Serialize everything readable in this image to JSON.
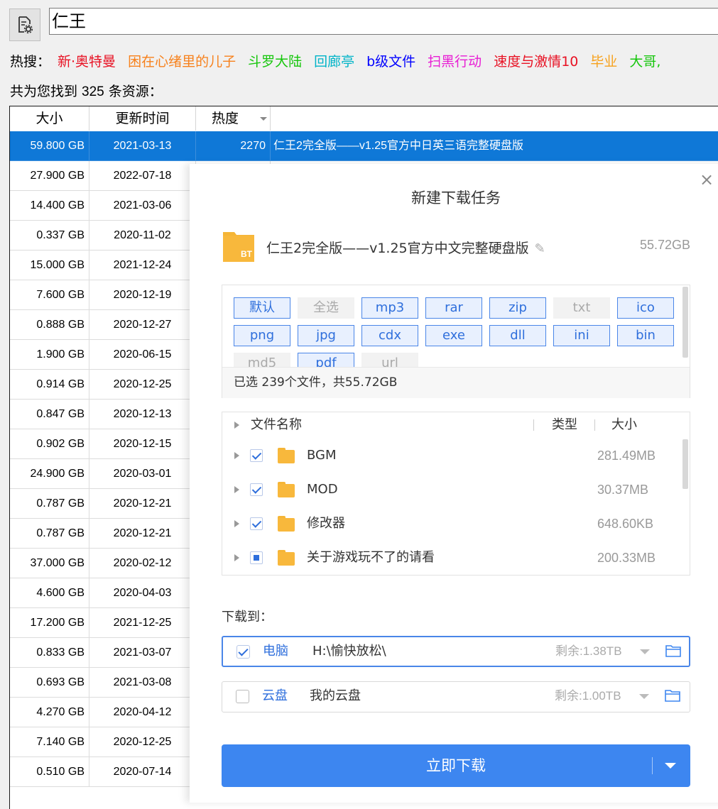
{
  "search": {
    "value": "仁王"
  },
  "hot": {
    "label": "热搜：",
    "keywords": [
      {
        "text": "新·奥特曼",
        "color": "#e81123"
      },
      {
        "text": "困在心绪里的儿子",
        "color": "#f7811c"
      },
      {
        "text": "斗罗大陆",
        "color": "#16c60c"
      },
      {
        "text": "回廊亭",
        "color": "#00b4c8"
      },
      {
        "text": "b级文件",
        "color": "#0000ff"
      },
      {
        "text": "扫黑行动",
        "color": "#e81cd4"
      },
      {
        "text": "速度与激情10",
        "color": "#e81123"
      },
      {
        "text": "毕业",
        "color": "#f7a11c"
      },
      {
        "text": "大哥,",
        "color": "#16c60c"
      }
    ]
  },
  "found": {
    "prefix": "共为您找到 ",
    "count": "325",
    "suffix": " 条资源："
  },
  "table": {
    "headers": [
      "大小",
      "更新时间",
      "热度"
    ],
    "rows": [
      {
        "size": "59.800 GB",
        "date": "2021-03-13",
        "heat": "2270",
        "name": "仁王2完全版——v1.25官方中日英三语完整硬盘版",
        "selected": true
      },
      {
        "size": "27.900 GB",
        "date": "2022-07-18"
      },
      {
        "size": "14.400 GB",
        "date": "2021-03-06"
      },
      {
        "size": "0.337 GB",
        "date": "2020-11-02"
      },
      {
        "size": "15.000 GB",
        "date": "2021-12-24"
      },
      {
        "size": "7.600 GB",
        "date": "2020-12-19"
      },
      {
        "size": "0.888 GB",
        "date": "2020-12-27"
      },
      {
        "size": "1.900 GB",
        "date": "2020-06-15"
      },
      {
        "size": "0.914 GB",
        "date": "2020-12-25"
      },
      {
        "size": "0.847 GB",
        "date": "2020-12-13"
      },
      {
        "size": "0.902 GB",
        "date": "2020-12-15"
      },
      {
        "size": "24.900 GB",
        "date": "2020-03-01"
      },
      {
        "size": "0.787 GB",
        "date": "2020-12-21"
      },
      {
        "size": "0.787 GB",
        "date": "2020-12-21"
      },
      {
        "size": "37.000 GB",
        "date": "2020-02-12"
      },
      {
        "size": "4.600 GB",
        "date": "2020-04-03"
      },
      {
        "size": "17.200 GB",
        "date": "2021-12-25"
      },
      {
        "size": "0.833 GB",
        "date": "2021-03-07"
      },
      {
        "size": "0.693 GB",
        "date": "2021-03-08"
      },
      {
        "size": "4.270 GB",
        "date": "2020-04-12"
      },
      {
        "size": "7.140 GB",
        "date": "2020-12-25"
      },
      {
        "size": "0.510 GB",
        "date": "2020-07-14"
      }
    ]
  },
  "dialog": {
    "close": "×",
    "title": "新建下载任务",
    "file_badge": "BT",
    "file_name": "仁王2完全版——v1.25官方中文完整硬盘版",
    "file_size": "55.72GB",
    "types": [
      {
        "label": "默认",
        "on": true
      },
      {
        "label": "全选",
        "on": false
      },
      {
        "label": "mp3",
        "on": true
      },
      {
        "label": "rar",
        "on": true
      },
      {
        "label": "zip",
        "on": true
      },
      {
        "label": "txt",
        "on": false
      },
      {
        "label": "ico",
        "on": true
      },
      {
        "label": "png",
        "on": true
      },
      {
        "label": "jpg",
        "on": true
      },
      {
        "label": "cdx",
        "on": true
      },
      {
        "label": "exe",
        "on": true
      },
      {
        "label": "dll",
        "on": true
      },
      {
        "label": "ini",
        "on": true
      },
      {
        "label": "bin",
        "on": true
      },
      {
        "label": "md5",
        "on": false
      },
      {
        "label": "pdf",
        "on": true
      },
      {
        "label": "url",
        "on": false
      }
    ],
    "selected_summary": "已选 239个文件，共55.72GB",
    "tree_header": {
      "name": "文件名称",
      "type": "类型",
      "size": "大小"
    },
    "tree_rows": [
      {
        "name": "BGM",
        "size": "281.49MB",
        "state": "checked"
      },
      {
        "name": "MOD",
        "size": "30.37MB",
        "state": "checked"
      },
      {
        "name": "修改器",
        "size": "648.60KB",
        "state": "checked"
      },
      {
        "name": "关于游戏玩不了的请看",
        "size": "200.33MB",
        "state": "partial"
      }
    ],
    "download_to": "下载到：",
    "dest_pc": {
      "label": "电脑",
      "path": "H:\\愉快放松\\",
      "free": "剩余:1.38TB",
      "checked": true
    },
    "dest_cloud": {
      "label": "云盘",
      "path": "我的云盘",
      "free": "剩余:1.00TB",
      "checked": false
    },
    "download_button": "立即下载"
  }
}
